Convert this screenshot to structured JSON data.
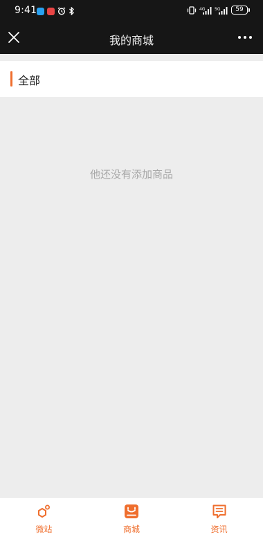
{
  "status_bar": {
    "time": "9:41",
    "battery": "59"
  },
  "title_bar": {
    "title": "我的商城"
  },
  "category": {
    "label": "全部"
  },
  "main": {
    "empty_message": "他还没有添加商品"
  },
  "bottom_nav": {
    "items": [
      {
        "label": "微站",
        "icon": "microsite-icon"
      },
      {
        "label": "商城",
        "icon": "shop-icon"
      },
      {
        "label": "资讯",
        "icon": "news-icon"
      }
    ]
  },
  "colors": {
    "accent": "#ef6e2d",
    "header_bg": "#161616",
    "page_bg": "#ededed"
  }
}
